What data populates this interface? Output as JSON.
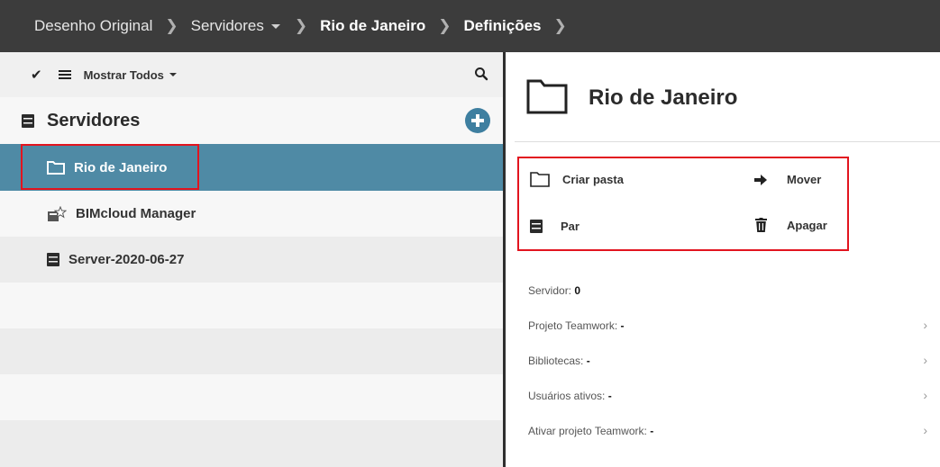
{
  "breadcrumb": {
    "items": [
      {
        "label": "Desenho Original"
      },
      {
        "label": "Servidores"
      },
      {
        "label": "Rio de Janeiro"
      },
      {
        "label": "Definições"
      }
    ]
  },
  "left_panel": {
    "toolbar": {
      "show_all_label": "Mostrar Todos",
      "icons": [
        "check-icon",
        "list-icon",
        "search-icon"
      ]
    },
    "header": {
      "title": "Servidores",
      "add_icon": "plus-circle-icon"
    },
    "items": [
      {
        "label": "Rio de Janeiro",
        "icon": "folder-icon",
        "selected": true
      },
      {
        "label": "BIMcloud Manager",
        "icon": "manager-icon",
        "selected": false
      },
      {
        "label": "Server-2020-06-27",
        "icon": "server-icon",
        "selected": false
      }
    ],
    "colors": {
      "selected": "#4f8aa5",
      "accent": "#3e7fa0"
    }
  },
  "right_panel": {
    "title": "Rio de Janeiro",
    "actions": {
      "create_folder": "Criar pasta",
      "move": "Mover",
      "pair": "Par",
      "delete": "Apagar"
    },
    "info": [
      {
        "label": "Servidor:",
        "value": "0",
        "has_arrow": false
      },
      {
        "label": "Projeto Teamwork:",
        "value": "-",
        "has_arrow": true
      },
      {
        "label": "Bibliotecas:",
        "value": "-",
        "has_arrow": true
      },
      {
        "label": "Usuários ativos:",
        "value": "-",
        "has_arrow": true
      },
      {
        "label": "Ativar projeto Teamwork:",
        "value": "-",
        "has_arrow": true
      }
    ],
    "highlight_color": "#e2141f"
  }
}
